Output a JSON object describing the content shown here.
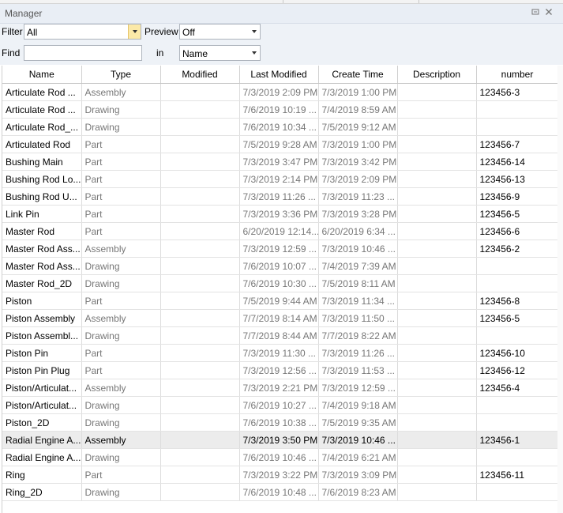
{
  "window": {
    "title": "Manager"
  },
  "filter": {
    "label": "Filter",
    "value": "All"
  },
  "preview": {
    "label": "Preview",
    "value": "Off"
  },
  "find": {
    "label": "Find",
    "value": "",
    "in_label": "in",
    "in_value": "Name"
  },
  "columns": [
    "Name",
    "Type",
    "Modified",
    "Last Modified",
    "Create Time",
    "Description",
    "number"
  ],
  "rows": [
    {
      "name": "Articulate Rod ...",
      "type": "Assembly",
      "modified": "",
      "last_modified": "7/3/2019 2:09 PM",
      "create_time": "7/3/2019 1:00 PM",
      "description": "",
      "number": "123456-3"
    },
    {
      "name": "Articulate Rod ...",
      "type": "Drawing",
      "modified": "",
      "last_modified": "7/6/2019 10:19 ...",
      "create_time": "7/4/2019 8:59 AM",
      "description": "",
      "number": ""
    },
    {
      "name": "Articulate Rod_...",
      "type": "Drawing",
      "modified": "",
      "last_modified": "7/6/2019 10:34 ...",
      "create_time": "7/5/2019 9:12 AM",
      "description": "",
      "number": ""
    },
    {
      "name": "Articulated Rod",
      "type": "Part",
      "modified": "",
      "last_modified": "7/5/2019 9:28 AM",
      "create_time": "7/3/2019 1:00 PM",
      "description": "",
      "number": "123456-7"
    },
    {
      "name": "Bushing Main",
      "type": "Part",
      "modified": "",
      "last_modified": "7/3/2019 3:47 PM",
      "create_time": "7/3/2019 3:42 PM",
      "description": "",
      "number": "123456-14"
    },
    {
      "name": "Bushing Rod Lo...",
      "type": "Part",
      "modified": "",
      "last_modified": "7/3/2019 2:14 PM",
      "create_time": "7/3/2019 2:09 PM",
      "description": "",
      "number": "123456-13"
    },
    {
      "name": "Bushing Rod U...",
      "type": "Part",
      "modified": "",
      "last_modified": "7/3/2019 11:26 ...",
      "create_time": "7/3/2019 11:23 ...",
      "description": "",
      "number": "123456-9"
    },
    {
      "name": "Link Pin",
      "type": "Part",
      "modified": "",
      "last_modified": "7/3/2019 3:36 PM",
      "create_time": "7/3/2019 3:28 PM",
      "description": "",
      "number": "123456-5"
    },
    {
      "name": "Master Rod",
      "type": "Part",
      "modified": "",
      "last_modified": "6/20/2019 12:14...",
      "create_time": "6/20/2019 6:34 ...",
      "description": "",
      "number": "123456-6"
    },
    {
      "name": "Master Rod Ass...",
      "type": "Assembly",
      "modified": "",
      "last_modified": "7/3/2019 12:59 ...",
      "create_time": "7/3/2019 10:46 ...",
      "description": "",
      "number": "123456-2"
    },
    {
      "name": "Master Rod Ass...",
      "type": "Drawing",
      "modified": "",
      "last_modified": "7/6/2019 10:07 ...",
      "create_time": "7/4/2019 7:39 AM",
      "description": "",
      "number": ""
    },
    {
      "name": "Master Rod_2D",
      "type": "Drawing",
      "modified": "",
      "last_modified": "7/6/2019 10:30 ...",
      "create_time": "7/5/2019 8:11 AM",
      "description": "",
      "number": ""
    },
    {
      "name": "Piston",
      "type": "Part",
      "modified": "",
      "last_modified": "7/5/2019 9:44 AM",
      "create_time": "7/3/2019 11:34 ...",
      "description": "",
      "number": "123456-8"
    },
    {
      "name": "Piston Assembly",
      "type": "Assembly",
      "modified": "",
      "last_modified": "7/7/2019 8:14 AM",
      "create_time": "7/3/2019 11:50 ...",
      "description": "",
      "number": "123456-5"
    },
    {
      "name": "Piston Assembl...",
      "type": "Drawing",
      "modified": "",
      "last_modified": "7/7/2019 8:44 AM",
      "create_time": "7/7/2019 8:22 AM",
      "description": "",
      "number": ""
    },
    {
      "name": "Piston Pin",
      "type": "Part",
      "modified": "",
      "last_modified": "7/3/2019 11:30 ...",
      "create_time": "7/3/2019 11:26 ...",
      "description": "",
      "number": "123456-10"
    },
    {
      "name": "Piston Pin Plug",
      "type": "Part",
      "modified": "",
      "last_modified": "7/3/2019 12:56 ...",
      "create_time": "7/3/2019 11:53 ...",
      "description": "",
      "number": "123456-12"
    },
    {
      "name": "Piston/Articulat...",
      "type": "Assembly",
      "modified": "",
      "last_modified": "7/3/2019 2:21 PM",
      "create_time": "7/3/2019 12:59 ...",
      "description": "",
      "number": "123456-4"
    },
    {
      "name": "Piston/Articulat...",
      "type": "Drawing",
      "modified": "",
      "last_modified": "7/6/2019 10:27 ...",
      "create_time": "7/4/2019 9:18 AM",
      "description": "",
      "number": ""
    },
    {
      "name": "Piston_2D",
      "type": "Drawing",
      "modified": "",
      "last_modified": "7/6/2019 10:38 ...",
      "create_time": "7/5/2019 9:35 AM",
      "description": "",
      "number": ""
    },
    {
      "name": "Radial Engine A...",
      "type": "Assembly",
      "modified": "",
      "last_modified": "7/3/2019 3:50 PM",
      "create_time": "7/3/2019 10:46 ...",
      "description": "",
      "number": "123456-1",
      "selected": true
    },
    {
      "name": "Radial Engine A...",
      "type": "Drawing",
      "modified": "",
      "last_modified": "7/6/2019 10:46 ...",
      "create_time": "7/4/2019 6:21 AM",
      "description": "",
      "number": ""
    },
    {
      "name": "Ring",
      "type": "Part",
      "modified": "",
      "last_modified": "7/3/2019 3:22 PM",
      "create_time": "7/3/2019 3:09 PM",
      "description": "",
      "number": "123456-11"
    },
    {
      "name": "Ring_2D",
      "type": "Drawing",
      "modified": "",
      "last_modified": "7/6/2019 10:48 ...",
      "create_time": "7/6/2019 8:23 AM",
      "description": "",
      "number": ""
    }
  ]
}
